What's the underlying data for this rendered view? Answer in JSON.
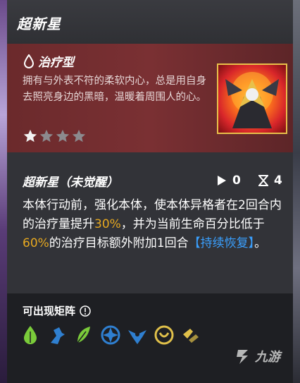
{
  "header": {
    "title": "超新星"
  },
  "card": {
    "type_label": "治疗型",
    "description": "拥有与外表不符的柔软内心，总是用自身去照亮身边的黑暗，温暖着周围人的心。",
    "rarity": 1,
    "rarity_max": 4
  },
  "skill": {
    "name": "超新星（未觉醒）",
    "play_value": "0",
    "hourglass_value": "4",
    "text_1": "本体行动前，强化本体，使本体异格者在2回合内的治疗量提升",
    "pct_1": "30%",
    "text_2": "，并为当前生命百分比低于",
    "pct_2": "60%",
    "text_3": "的治疗目标额外附加1回合",
    "keyword": "【持续恢复】",
    "text_4": "。"
  },
  "footer": {
    "title": "可出现矩阵",
    "matrix_icons": [
      "leaf-drop-icon",
      "runner-icon",
      "feather-icon",
      "compass-star-icon",
      "winged-emblem-icon",
      "shield-crest-icon",
      "scroll-icon"
    ]
  },
  "watermark": {
    "text": "九游"
  },
  "colors": {
    "highlight": "#e6a820",
    "keyword": "#3aa0ff",
    "card_red": "#7a3033",
    "matrix_green": "#7acb3a",
    "matrix_blue": "#2f7fd0",
    "matrix_gold": "#e0c04a"
  }
}
